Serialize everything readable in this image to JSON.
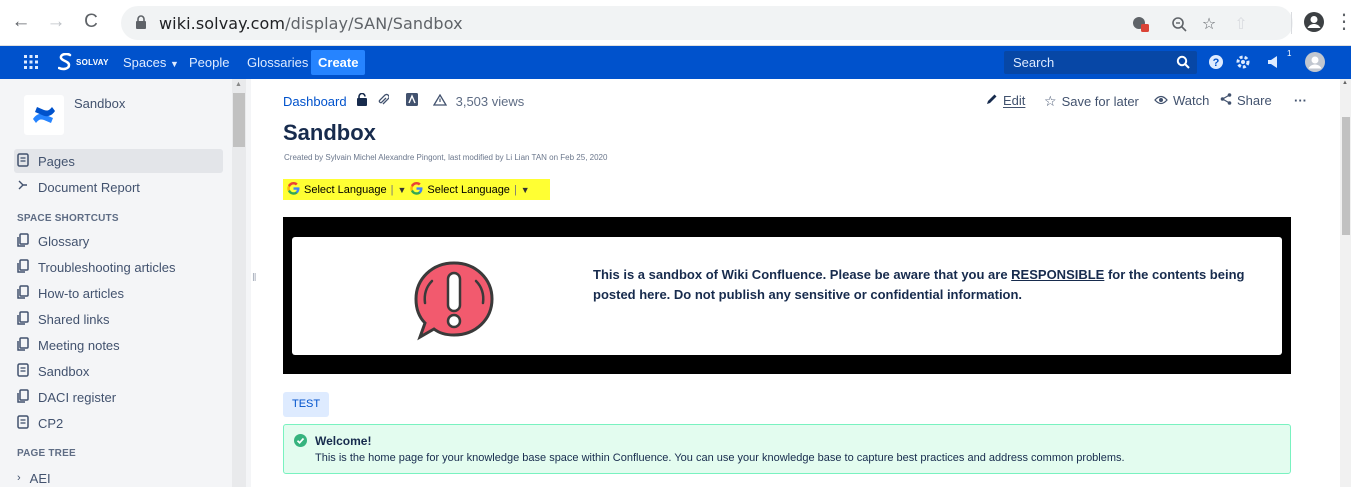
{
  "browser": {
    "url_domain": "wiki.solvay.com",
    "url_path": "/display/SAN/Sandbox"
  },
  "topnav": {
    "logo_text": "SOLVAY",
    "spaces_label": "Spaces",
    "people_label": "People",
    "glossaries_label": "Glossaries",
    "create_label": "Create",
    "search_placeholder": "Search",
    "notification_count": "1"
  },
  "sidebar": {
    "space_name": "Sandbox",
    "pages_label": "Pages",
    "document_report_label": "Document Report",
    "shortcuts_heading": "SPACE SHORTCUTS",
    "shortcuts": [
      {
        "label": "Glossary"
      },
      {
        "label": "Troubleshooting articles"
      },
      {
        "label": "How-to articles"
      },
      {
        "label": "Shared links"
      },
      {
        "label": "Meeting notes"
      },
      {
        "label": "Sandbox"
      },
      {
        "label": "DACI register"
      },
      {
        "label": "CP2"
      }
    ],
    "page_tree_heading": "PAGE TREE",
    "tree_items": [
      {
        "label": "AEI"
      }
    ]
  },
  "main": {
    "breadcrumb_dashboard": "Dashboard",
    "views": "3,503 views",
    "actions": {
      "edit": "Edit",
      "save_for_later": "Save for later",
      "watch": "Watch",
      "share": "Share",
      "more": "···"
    },
    "title": "Sandbox",
    "meta": "Created by Sylvain Michel Alexandre Pingont, last modified by Li Lian TAN on Feb 25, 2020",
    "language_selector": {
      "label_1": "Select Language",
      "label_2": "Select Language"
    },
    "banner": {
      "text_before": "This is a sandbox of Wiki Confluence. Please be aware that you are ",
      "text_emphasis": "RESPONSIBLE",
      "text_after": " for the contents being posted here. Do not publish any sensitive or confidential information."
    },
    "tag": "TEST",
    "welcome": {
      "title": "Welcome!",
      "body": "This is the home page for your knowledge base space within Confluence. You can use your knowledge base to capture best practices and address common problems."
    }
  },
  "colors": {
    "nav_blue": "#0052cc",
    "create_blue": "#2684ff",
    "highlight_yellow": "#ffff33",
    "alert_pink": "#f25a6e",
    "success_green": "#36b37e"
  }
}
